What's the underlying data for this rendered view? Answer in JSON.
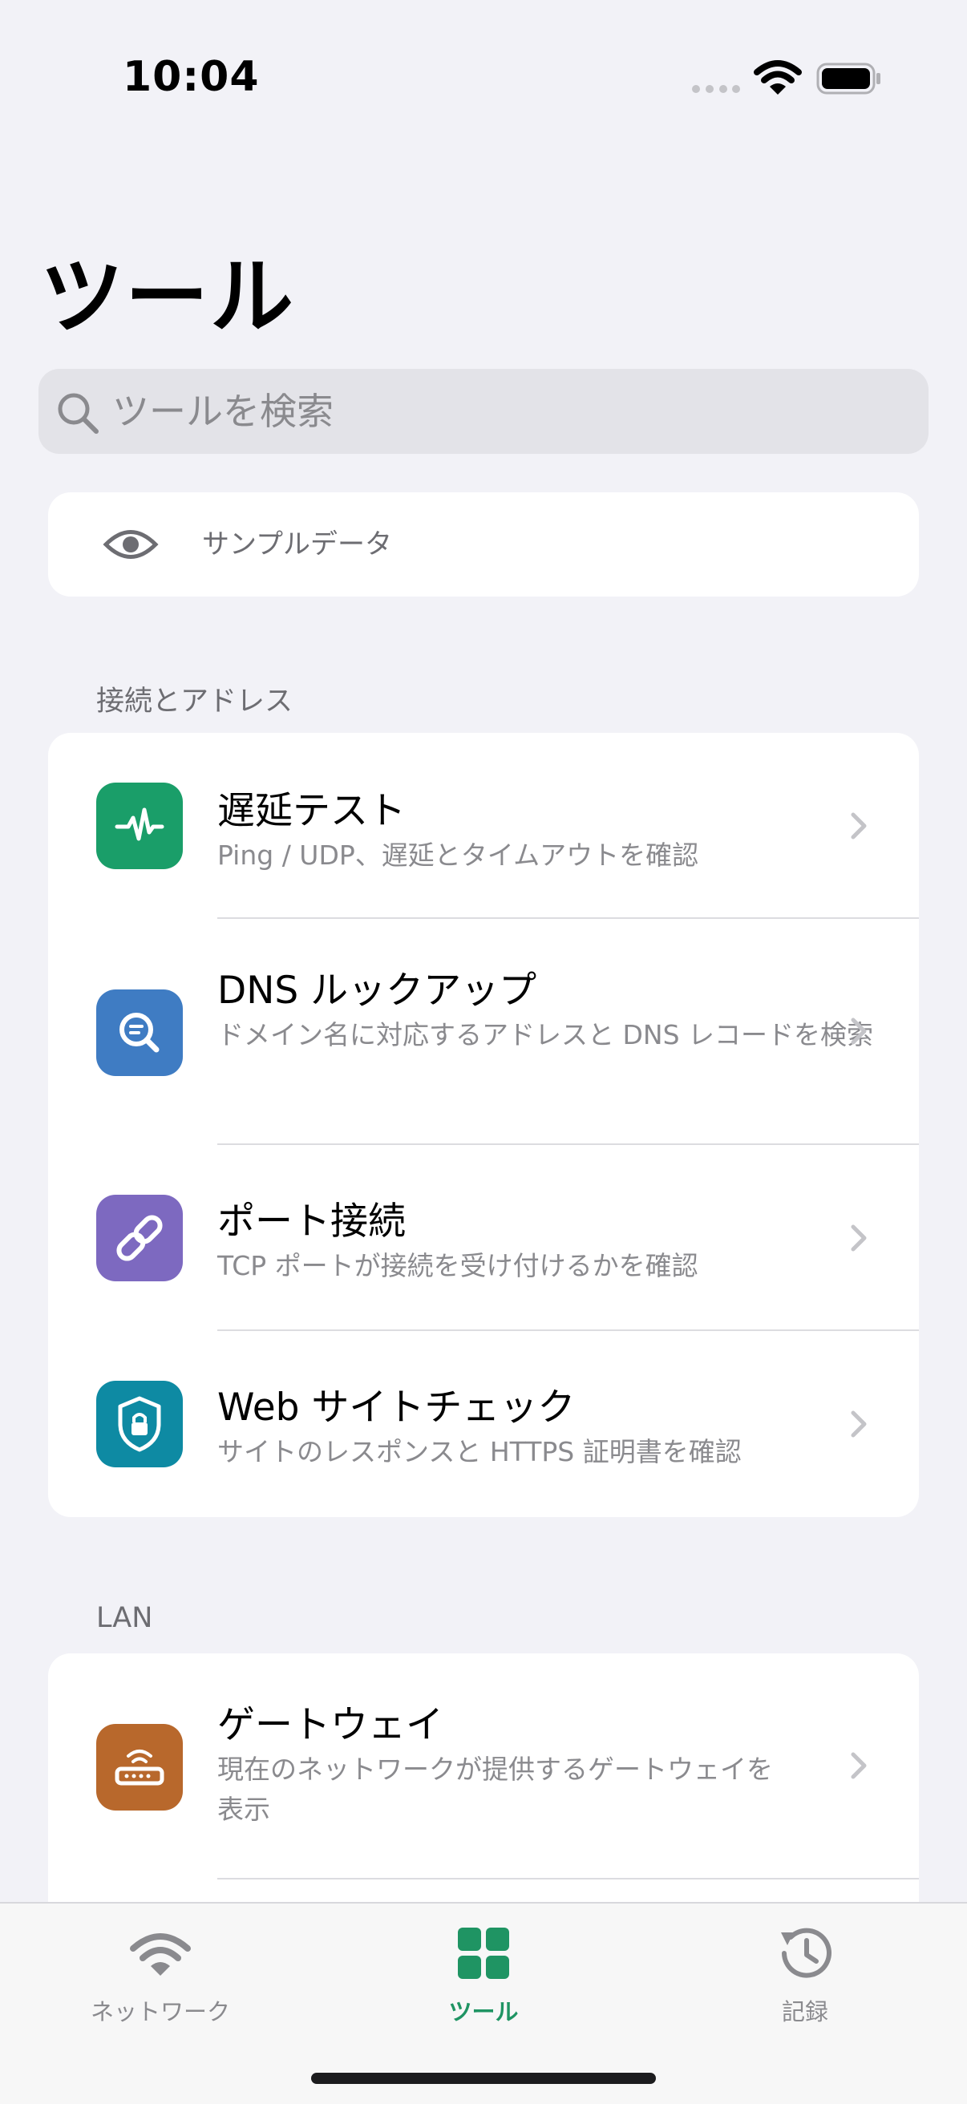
{
  "status_bar": {
    "time": "10:04"
  },
  "page_title": "ツール",
  "search": {
    "placeholder": "ツールを検索",
    "value": ""
  },
  "sample": {
    "label": "サンプルデータ",
    "icon": "eye-icon"
  },
  "sections": [
    {
      "header": "接続とアドレス",
      "rows": [
        {
          "title": "遅延テスト",
          "subtitle": "Ping / UDP、遅延とタイムアウトを確認",
          "icon": "waveform-icon",
          "color": "#1a9e69"
        },
        {
          "title": "DNS ルックアップ",
          "subtitle": "ドメイン名に対応するアドレスと DNS レコードを検索",
          "icon": "magnifier-doc-icon",
          "color": "#3f7cc3"
        },
        {
          "title": "ポート接続",
          "subtitle": "TCP ポートが接続を受け付けるかを確認",
          "icon": "link-icon",
          "color": "#7d69c0"
        },
        {
          "title": "Web サイトチェック",
          "subtitle": "サイトのレスポンスと HTTPS 証明書を確認",
          "icon": "shield-lock-icon",
          "color": "#0e8aa3"
        }
      ]
    },
    {
      "header": "LAN",
      "rows": [
        {
          "title": "ゲートウェイ",
          "subtitle": "現在のネットワークが提供するゲートウェイを表示",
          "icon": "router-icon",
          "color": "#b8682c"
        }
      ]
    }
  ],
  "tab_bar": {
    "tabs": [
      {
        "label": "ネットワーク",
        "icon": "wifi-icon",
        "active": false
      },
      {
        "label": "ツール",
        "icon": "grid-icon",
        "active": true
      },
      {
        "label": "記録",
        "icon": "history-icon",
        "active": false
      }
    ],
    "active_color": "#1f9463",
    "inactive_color": "#8a8a8e"
  }
}
